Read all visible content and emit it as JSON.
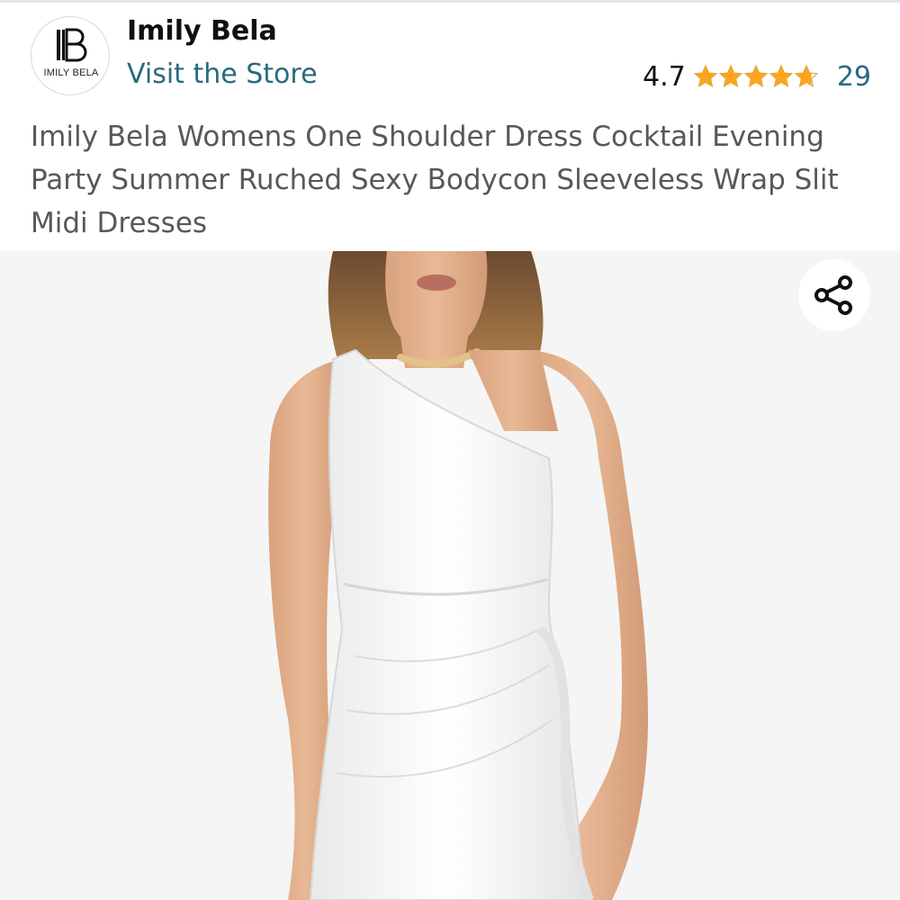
{
  "store": {
    "logo_text": "IMILY BELA",
    "brand_name": "Imily Bela",
    "visit_label": "Visit the Store"
  },
  "rating": {
    "value": "4.7",
    "stars_filled": 4.7,
    "stars_total": 5,
    "review_count": "29",
    "star_color": "#ffa41c"
  },
  "product": {
    "title": "Imily Bela Womens One Shoulder Dress Cocktail Evening Party Summer Ruched Sexy Bodycon Sleeveless Wrap Slit Midi Dresses"
  },
  "image": {
    "icon": "share-icon"
  },
  "colors": {
    "link": "#2a6a7f",
    "title_text": "#565959",
    "image_bg": "#f5f5f5"
  }
}
